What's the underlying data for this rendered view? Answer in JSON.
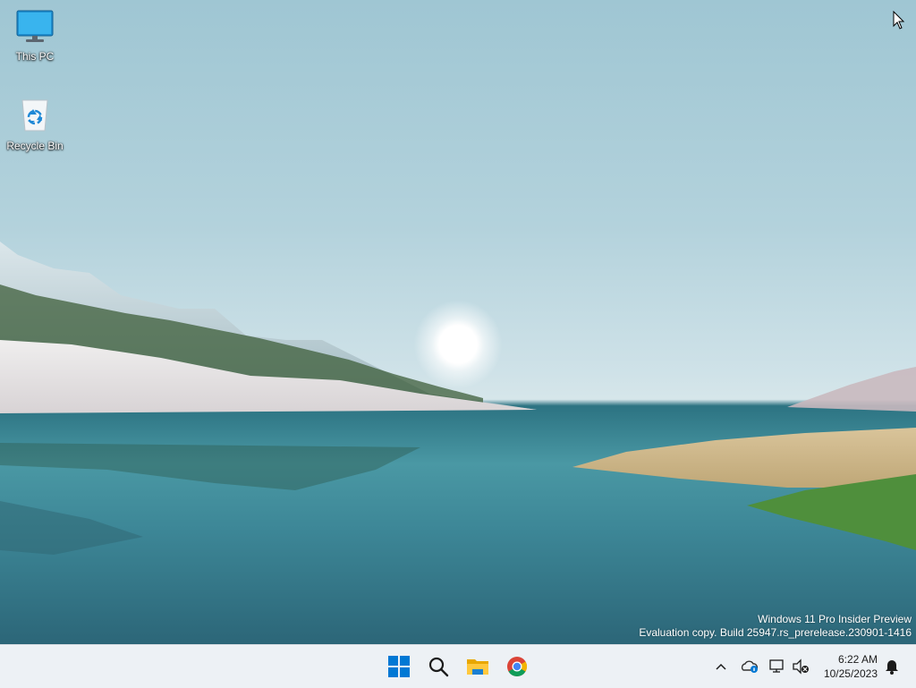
{
  "desktop": {
    "icons": [
      {
        "label": "This PC",
        "icon": "computer-monitor-icon"
      },
      {
        "label": "Recycle Bin",
        "icon": "recycle-bin-icon"
      }
    ],
    "watermark": {
      "line1": "Windows 11 Pro Insider Preview",
      "line2": "Evaluation copy. Build 25947.rs_prerelease.230901-1416"
    }
  },
  "taskbar": {
    "apps": [
      {
        "name": "Start",
        "icon": "windows-start-icon"
      },
      {
        "name": "Search",
        "icon": "search-icon"
      },
      {
        "name": "File Explorer",
        "icon": "folder-icon"
      },
      {
        "name": "Google Chrome",
        "icon": "chrome-icon"
      }
    ],
    "tray": {
      "icons": [
        "chevron-up-icon",
        "onedrive-icon",
        "network-icon",
        "volume-muted-icon",
        "notification-bell-icon"
      ],
      "time": "6:22 AM",
      "date": "10/25/2023"
    }
  },
  "colors": {
    "accent": "#0078d4",
    "taskbar_bg": "#edf1f5"
  }
}
